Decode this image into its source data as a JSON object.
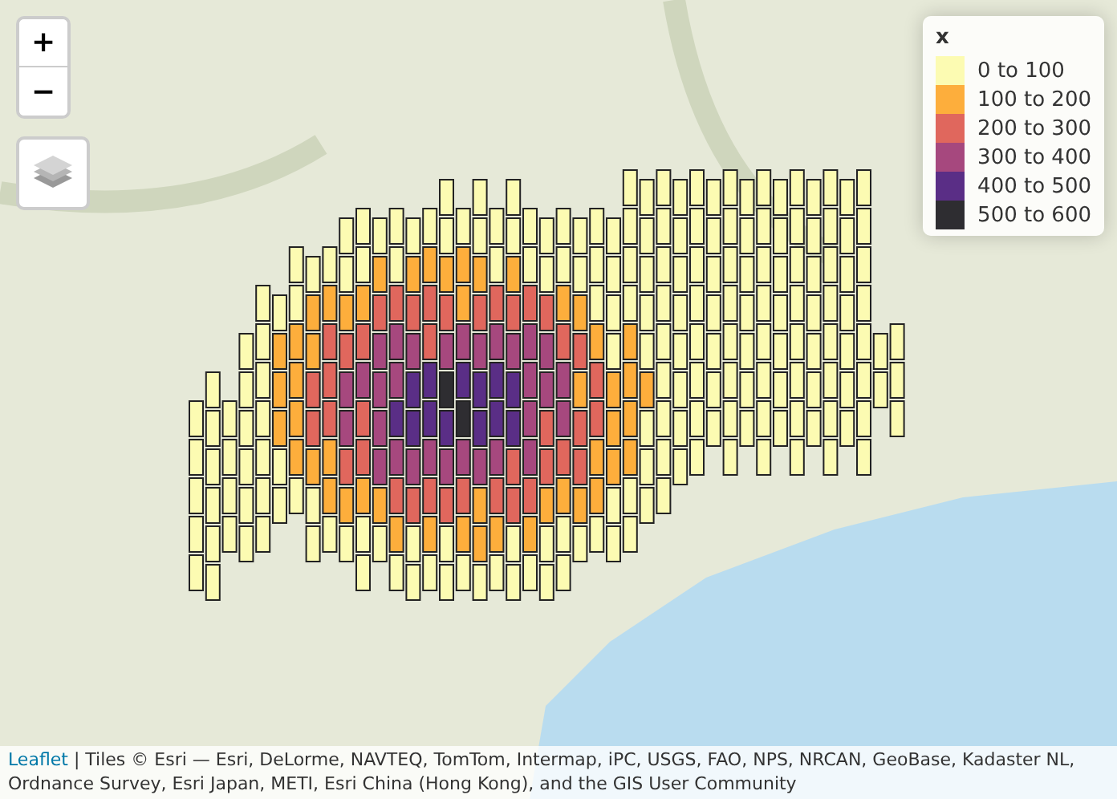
{
  "zoom_controls": [
    {
      "label": "+"
    },
    {
      "label": "−"
    }
  ],
  "legend": {
    "title": "x",
    "items": [
      {
        "label": "0 to 100",
        "color": "#fcfbb2"
      },
      {
        "label": "100 to 200",
        "color": "#fdae3c"
      },
      {
        "label": "200 to 300",
        "color": "#e0675d"
      },
      {
        "label": "300 to 400",
        "color": "#a6487e"
      },
      {
        "label": "400 to 500",
        "color": "#5a2e86"
      },
      {
        "label": "500 to 600",
        "color": "#2e2d31"
      }
    ]
  },
  "attribution": {
    "link": "Leaflet",
    "text": "| Tiles © Esri — Esri, DeLorme, NAVTEQ, TomTom, Intermap, iPC, USGS, FAO, NPS, NRCAN, GeoBase, Kadaster NL, Ordnance Survey, Esri Japan, METI, Esri China (Hong Kong), and the GIS User Community"
  }
}
